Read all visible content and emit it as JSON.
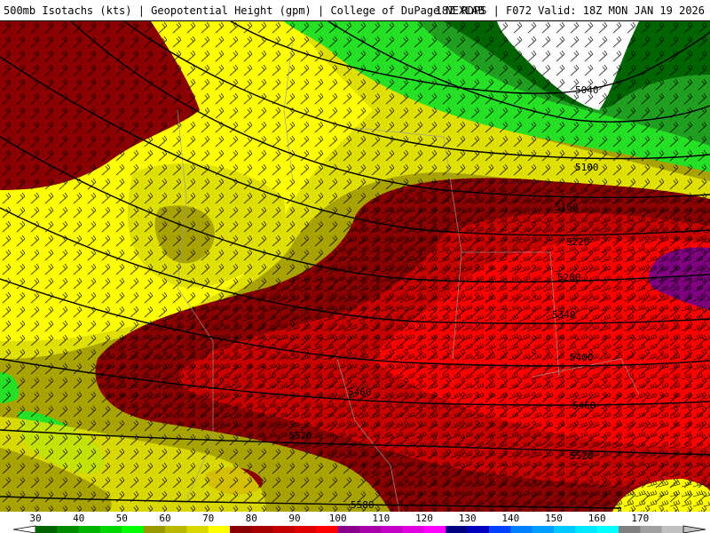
{
  "header": {
    "title_left": "500mb Isotachs (kts) | Geopotential Height (gpm) | College of DuPage NEXLAB",
    "title_right": "18Z RDPS | F072 Valid: 18Z MON JAN 19 2026"
  },
  "map": {
    "contour_labels": [
      "5040",
      "5100",
      "5160",
      "5220",
      "5280",
      "5340",
      "5400",
      "5460",
      "5460",
      "5520",
      "5520",
      "5580"
    ],
    "isotach_colors": {
      "30": "#006400",
      "40": "#1f9e1f",
      "50": "#26e026",
      "60": "#a8a300",
      "70": "#e0e000",
      "75": "#ffff00",
      "80": "#8b0000",
      "90": "#c80000",
      "100": "#ff0000",
      "130": "#800080"
    }
  },
  "colorbar": {
    "tick_labels": [
      "30",
      "40",
      "50",
      "60",
      "70",
      "80",
      "90",
      "100",
      "110",
      "120",
      "130",
      "140",
      "150",
      "160",
      "170"
    ],
    "swatches": [
      "#006400",
      "#008c00",
      "#00b400",
      "#00d800",
      "#00ff00",
      "#999900",
      "#b8b800",
      "#d8d800",
      "#ffff00",
      "#8b0000",
      "#a80000",
      "#c40000",
      "#e00000",
      "#ff0000",
      "#8b008b",
      "#a800a8",
      "#c400c4",
      "#e000e0",
      "#ff00ff",
      "#000080",
      "#0000c0",
      "#0040ff",
      "#0080ff",
      "#00a0ff",
      "#00c8ff",
      "#00e8ff",
      "#00ffff",
      "#808080",
      "#a0a0a0",
      "#c0c0c0"
    ]
  }
}
